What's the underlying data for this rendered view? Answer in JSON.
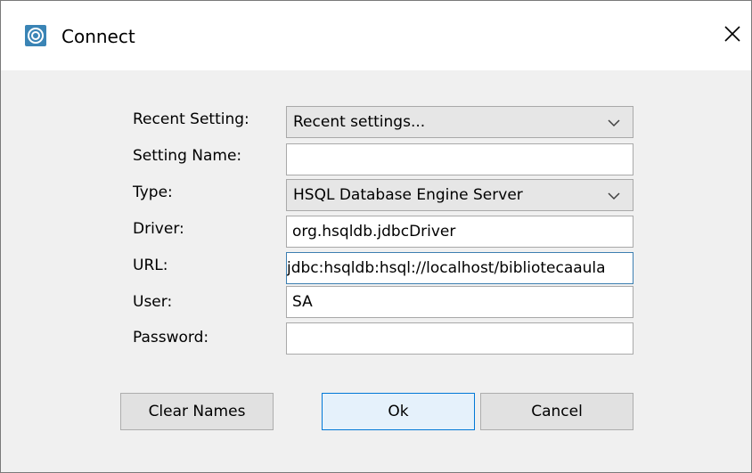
{
  "window": {
    "title": "Connect",
    "close_glyph": "×"
  },
  "form": {
    "recent_setting": {
      "label": "Recent Setting:",
      "value": "Recent settings..."
    },
    "setting_name": {
      "label": "Setting Name:",
      "value": ""
    },
    "type": {
      "label": "Type:",
      "value": "HSQL Database Engine Server"
    },
    "driver": {
      "label": "Driver:",
      "value": "org.hsqldb.jdbcDriver"
    },
    "url": {
      "label": "URL:",
      "value": "jdbc:hsqldb:hsql://localhost/bibliotecaaula"
    },
    "user": {
      "label": "User:",
      "value": "SA"
    },
    "password": {
      "label": "Password:",
      "value": ""
    }
  },
  "buttons": {
    "clear_names": "Clear Names",
    "ok": "Ok",
    "cancel": "Cancel"
  },
  "colors": {
    "window_bg": "#f0f0f0",
    "titlebar_bg": "#ffffff",
    "focus_border": "#3c7fb1",
    "default_button_border": "#0078d7",
    "app_icon": "#3a84b5"
  },
  "icons": {
    "app": "hsqldb-app-icon",
    "close": "close-icon",
    "dropdown": "chevron-down-icon"
  }
}
